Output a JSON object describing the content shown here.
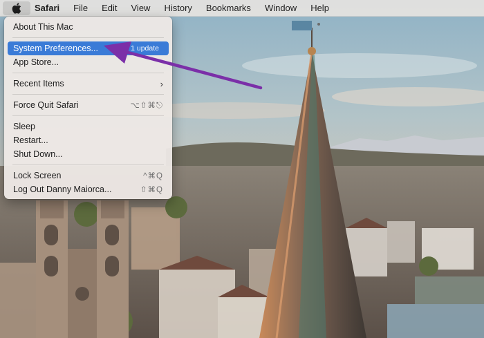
{
  "menubar": {
    "app_name": "Safari",
    "items": [
      {
        "label": "File"
      },
      {
        "label": "Edit"
      },
      {
        "label": "View"
      },
      {
        "label": "History"
      },
      {
        "label": "Bookmarks"
      },
      {
        "label": "Window"
      },
      {
        "label": "Help"
      }
    ]
  },
  "apple_menu": {
    "about": "About This Mac",
    "system_prefs": "System Preferences...",
    "system_prefs_badge": "1 update",
    "app_store": "App Store...",
    "recent_items": "Recent Items",
    "recent_items_chevron": "›",
    "force_quit": "Force Quit Safari",
    "force_quit_shortcut": "⌥⇧⌘⎋",
    "sleep": "Sleep",
    "restart": "Restart...",
    "shut_down": "Shut Down...",
    "lock_screen": "Lock Screen",
    "lock_screen_shortcut": "^⌘Q",
    "log_out": "Log Out Danny Maiorca...",
    "log_out_shortcut": "⇧⌘Q"
  },
  "icons": {
    "apple": "apple-logo-icon",
    "submenu": "chevron-right-icon"
  },
  "colors": {
    "highlight": "#3a7bd7",
    "annotation_arrow": "#7b2fa8"
  }
}
